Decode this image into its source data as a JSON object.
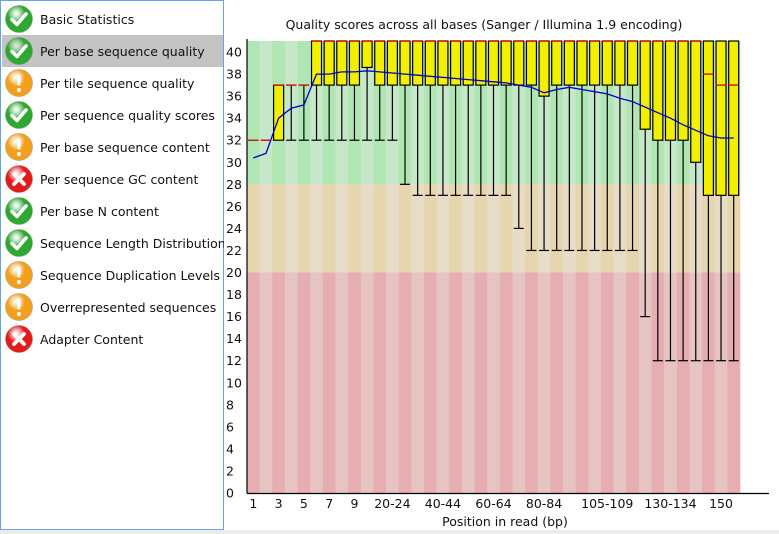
{
  "sidebar": {
    "items": [
      {
        "label": "Basic Statistics",
        "status": "pass",
        "icon": "check-icon"
      },
      {
        "label": "Per base sequence quality",
        "status": "pass",
        "icon": "check-icon",
        "selected": true
      },
      {
        "label": "Per tile sequence quality",
        "status": "warn",
        "icon": "warning-icon"
      },
      {
        "label": "Per sequence quality scores",
        "status": "pass",
        "icon": "check-icon"
      },
      {
        "label": "Per base sequence content",
        "status": "warn",
        "icon": "warning-icon"
      },
      {
        "label": "Per sequence GC content",
        "status": "fail",
        "icon": "fail-icon"
      },
      {
        "label": "Per base N content",
        "status": "pass",
        "icon": "check-icon"
      },
      {
        "label": "Sequence Length Distribution",
        "status": "pass",
        "icon": "check-icon"
      },
      {
        "label": "Sequence Duplication Levels",
        "status": "warn",
        "icon": "warning-icon"
      },
      {
        "label": "Overrepresented sequences",
        "status": "warn",
        "icon": "warning-icon"
      },
      {
        "label": "Adapter Content",
        "status": "fail",
        "icon": "fail-icon"
      }
    ]
  },
  "colors": {
    "pass": "#2ea82e",
    "warn": "#f5a01c",
    "fail": "#e31b1b",
    "box": "#f2f000",
    "median": "#cc0000",
    "mean": "#0000cc",
    "green_dark": "#b0e6b4",
    "green_light": "#c6e8c8",
    "amber_dark": "#e6d6ae",
    "amber_light": "#e6dcc8",
    "red_dark": "#e6aeb0",
    "red_light": "#e6c4c4"
  },
  "chart_data": {
    "type": "boxplot",
    "title": "Quality scores across all bases (Sanger / Illumina 1.9 encoding)",
    "xlabel": "Position in read (bp)",
    "ylabel": "",
    "ylim": [
      0,
      41
    ],
    "yticks": [
      0,
      2,
      4,
      6,
      8,
      10,
      12,
      14,
      16,
      18,
      20,
      22,
      24,
      26,
      28,
      30,
      32,
      34,
      36,
      38,
      40
    ],
    "bands": [
      {
        "from": 28,
        "to": 41,
        "zone": "good"
      },
      {
        "from": 20,
        "to": 28,
        "zone": "reasonable"
      },
      {
        "from": 0,
        "to": 20,
        "zone": "poor"
      }
    ],
    "xtick_labels": [
      {
        "col": 0,
        "label": "1"
      },
      {
        "col": 2,
        "label": "3"
      },
      {
        "col": 4,
        "label": "5"
      },
      {
        "col": 6,
        "label": "7"
      },
      {
        "col": 8,
        "label": "9"
      },
      {
        "col": 11,
        "label": "20-24"
      },
      {
        "col": 15,
        "label": "40-44"
      },
      {
        "col": 19,
        "label": "60-64"
      },
      {
        "col": 23,
        "label": "80-84"
      },
      {
        "col": 28,
        "label": "105-109"
      },
      {
        "col": 33,
        "label": "130-134"
      },
      {
        "col": 37,
        "label": "150"
      }
    ],
    "columns": [
      {
        "low": 32,
        "q1": 32,
        "median": 32,
        "q3": 32,
        "high": 32,
        "mean": 30.4
      },
      {
        "low": 32,
        "q1": 32,
        "median": 32,
        "q3": 32,
        "high": 32,
        "mean": 30.8
      },
      {
        "low": 32,
        "q1": 32,
        "median": 37,
        "q3": 37,
        "high": 37,
        "mean": 34.0
      },
      {
        "low": 32,
        "q1": 37,
        "median": 37,
        "q3": 37,
        "high": 37,
        "mean": 34.9
      },
      {
        "low": 32,
        "q1": 37,
        "median": 37,
        "q3": 37,
        "high": 37,
        "mean": 35.2
      },
      {
        "low": 32,
        "q1": 37,
        "median": 41,
        "q3": 41,
        "high": 41,
        "mean": 38.0
      },
      {
        "low": 32,
        "q1": 37,
        "median": 41,
        "q3": 41,
        "high": 41,
        "mean": 38.0
      },
      {
        "low": 32,
        "q1": 37,
        "median": 41,
        "q3": 41,
        "high": 41,
        "mean": 38.2
      },
      {
        "low": 32,
        "q1": 37,
        "median": 41,
        "q3": 41,
        "high": 41,
        "mean": 38.2
      },
      {
        "low": 32,
        "q1": 38.6,
        "median": 41,
        "q3": 41,
        "high": 41,
        "mean": 38.3
      },
      {
        "low": 32,
        "q1": 37,
        "median": 41,
        "q3": 41,
        "high": 41,
        "mean": 38.2
      },
      {
        "low": 32,
        "q1": 37,
        "median": 41,
        "q3": 41,
        "high": 41,
        "mean": 38.1
      },
      {
        "low": 28,
        "q1": 37,
        "median": 41,
        "q3": 41,
        "high": 41,
        "mean": 38.0
      },
      {
        "low": 27,
        "q1": 37,
        "median": 41,
        "q3": 41,
        "high": 41,
        "mean": 37.9
      },
      {
        "low": 27,
        "q1": 37,
        "median": 41,
        "q3": 41,
        "high": 41,
        "mean": 37.8
      },
      {
        "low": 27,
        "q1": 37,
        "median": 41,
        "q3": 41,
        "high": 41,
        "mean": 37.7
      },
      {
        "low": 27,
        "q1": 37,
        "median": 41,
        "q3": 41,
        "high": 41,
        "mean": 37.6
      },
      {
        "low": 27,
        "q1": 37,
        "median": 41,
        "q3": 41,
        "high": 41,
        "mean": 37.5
      },
      {
        "low": 27,
        "q1": 37,
        "median": 41,
        "q3": 41,
        "high": 41,
        "mean": 37.4
      },
      {
        "low": 27,
        "q1": 37,
        "median": 41,
        "q3": 41,
        "high": 41,
        "mean": 37.3
      },
      {
        "low": 27,
        "q1": 37,
        "median": 41,
        "q3": 41,
        "high": 41,
        "mean": 37.2
      },
      {
        "low": 24,
        "q1": 37,
        "median": 41,
        "q3": 41,
        "high": 41,
        "mean": 37.0
      },
      {
        "low": 22,
        "q1": 37,
        "median": 41,
        "q3": 41,
        "high": 41,
        "mean": 36.8
      },
      {
        "low": 22,
        "q1": 36,
        "median": 41,
        "q3": 41,
        "high": 41,
        "mean": 36.3
      },
      {
        "low": 22,
        "q1": 37,
        "median": 41,
        "q3": 41,
        "high": 41,
        "mean": 36.6
      },
      {
        "low": 22,
        "q1": 37,
        "median": 41,
        "q3": 41,
        "high": 41,
        "mean": 36.8
      },
      {
        "low": 22,
        "q1": 37,
        "median": 41,
        "q3": 41,
        "high": 41,
        "mean": 36.6
      },
      {
        "low": 22,
        "q1": 37,
        "median": 41,
        "q3": 41,
        "high": 41,
        "mean": 36.4
      },
      {
        "low": 22,
        "q1": 37,
        "median": 41,
        "q3": 41,
        "high": 41,
        "mean": 36.2
      },
      {
        "low": 22,
        "q1": 37,
        "median": 41,
        "q3": 41,
        "high": 41,
        "mean": 35.8
      },
      {
        "low": 22,
        "q1": 37,
        "median": 41,
        "q3": 41,
        "high": 41,
        "mean": 35.5
      },
      {
        "low": 16,
        "q1": 33,
        "median": 41,
        "q3": 41,
        "high": 41,
        "mean": 35.0
      },
      {
        "low": 12,
        "q1": 32,
        "median": 41,
        "q3": 41,
        "high": 41,
        "mean": 34.5
      },
      {
        "low": 12,
        "q1": 32,
        "median": 41,
        "q3": 41,
        "high": 41,
        "mean": 34.0
      },
      {
        "low": 12,
        "q1": 32,
        "median": 41,
        "q3": 41,
        "high": 41,
        "mean": 33.4
      },
      {
        "low": 12,
        "q1": 30,
        "median": 41,
        "q3": 41,
        "high": 41,
        "mean": 32.9
      },
      {
        "low": 12,
        "q1": 27,
        "median": 38,
        "q3": 41,
        "high": 41,
        "mean": 32.4
      },
      {
        "low": 12,
        "q1": 27,
        "median": 37,
        "q3": 41,
        "high": 41,
        "mean": 32.2
      },
      {
        "low": 12,
        "q1": 27,
        "median": 37,
        "q3": 41,
        "high": 41,
        "mean": 32.2
      }
    ]
  }
}
